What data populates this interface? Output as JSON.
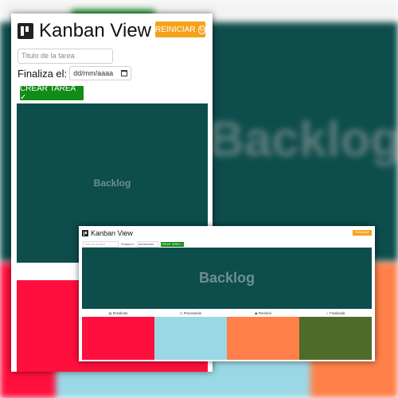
{
  "app": {
    "title": "Kanban View",
    "reset_label": "REINICIAR",
    "task_placeholder": "Titulo de la tarea",
    "date_label": "Finaliza el:",
    "date_placeholder": "dd/mm/aaaa",
    "create_label": "CREAR TAREA ✓",
    "backlog_label": "Backlog"
  },
  "background": {
    "backlog_label": "Backlog"
  },
  "desktop": {
    "title": "Kanban View",
    "reset_label": "REINICIAR",
    "task_placeholder": "Titulo de la tarea",
    "date_label": "Finaliza el:",
    "date_placeholder": "dd/mm/aaaa",
    "create_label": "CREAR TAREA ✓",
    "backlog_label": "Backlog",
    "columns": [
      {
        "label": "Pendiente",
        "icon": "clipboard-icon",
        "color": "#ff0f3d"
      },
      {
        "label": "Procesando",
        "icon": "clock-icon",
        "color": "#9bd8e6"
      },
      {
        "label": "Revisión",
        "icon": "eye-icon",
        "color": "#ff8049"
      },
      {
        "label": "Finalizada",
        "icon": "check-icon",
        "color": "#4f6b2a"
      }
    ]
  },
  "colors": {
    "backlog": "#0d4d4c",
    "reset": "#f5a21b",
    "create": "#118c17"
  }
}
